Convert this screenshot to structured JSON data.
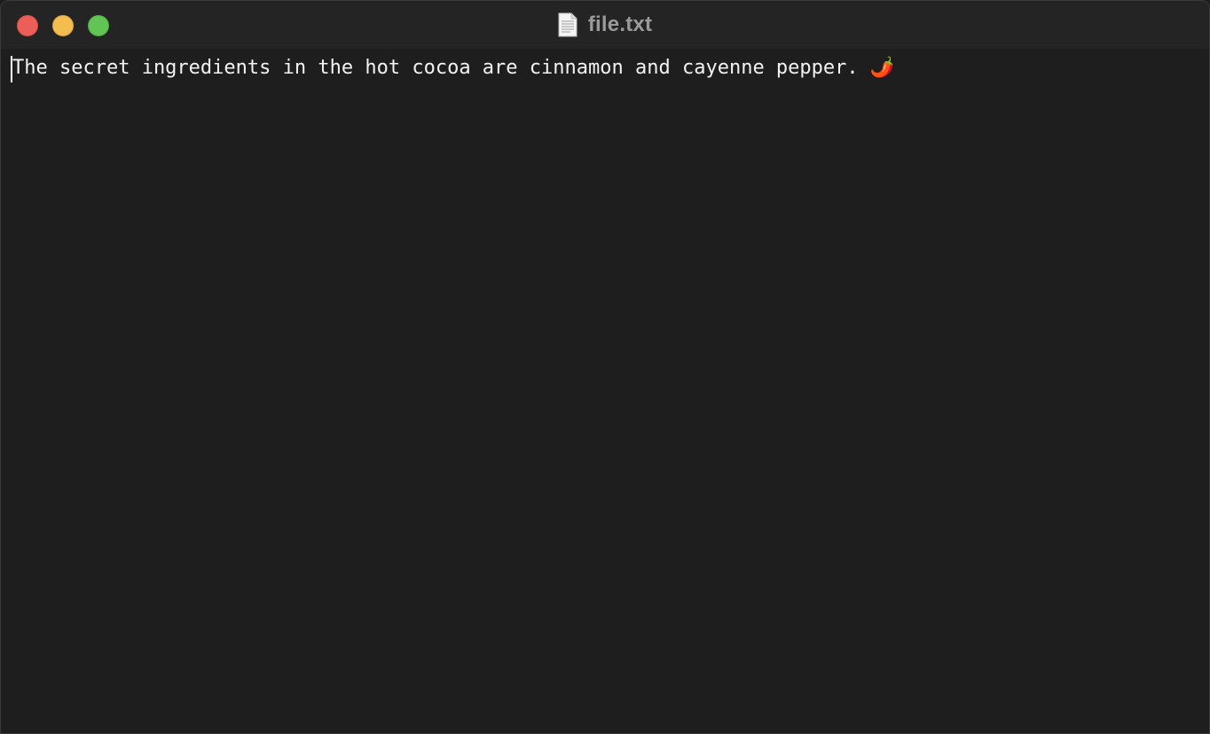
{
  "window": {
    "title": "file.txt",
    "title_icon": "text-document-icon",
    "buttons": {
      "close_color": "#ec5f58",
      "minimize_color": "#f4bd4f",
      "zoom_color": "#61c454"
    }
  },
  "editor": {
    "lines": [
      "The secret ingredients in the hot cocoa are cinnamon and cayenne pepper. 🌶️"
    ],
    "text_color": "#f2f2f2",
    "background_color": "#1e1e1e"
  }
}
